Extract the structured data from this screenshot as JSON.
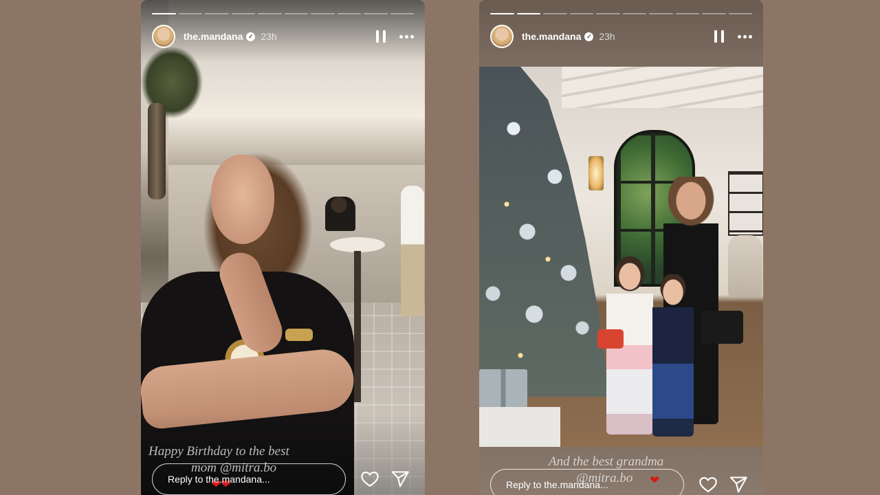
{
  "stories": [
    {
      "username": "the.mandana",
      "time": "23h",
      "progress_total": 10,
      "progress_done": 1,
      "caption_lines": [
        "Happy Birthday to the best",
        "mom @mitra.bo"
      ],
      "caption_emoji": "❤❤",
      "reply_placeholder": "Reply to the.mandana..."
    },
    {
      "username": "the.mandana",
      "time": "23h",
      "progress_total": 10,
      "progress_done": 2,
      "caption_lines": [
        "And the best grandma",
        "@mitra.bo"
      ],
      "caption_emoji": "❤",
      "reply_placeholder": "Reply to the.mandana..."
    }
  ],
  "icons": {
    "verified": "verified-badge-icon",
    "pause": "pause-icon",
    "more": "more-options-icon",
    "like": "heart-icon",
    "share": "send-icon"
  },
  "colors": {
    "background": "#8d7565",
    "heart_emoji": "#d11e1e",
    "text": "#ffffff"
  }
}
